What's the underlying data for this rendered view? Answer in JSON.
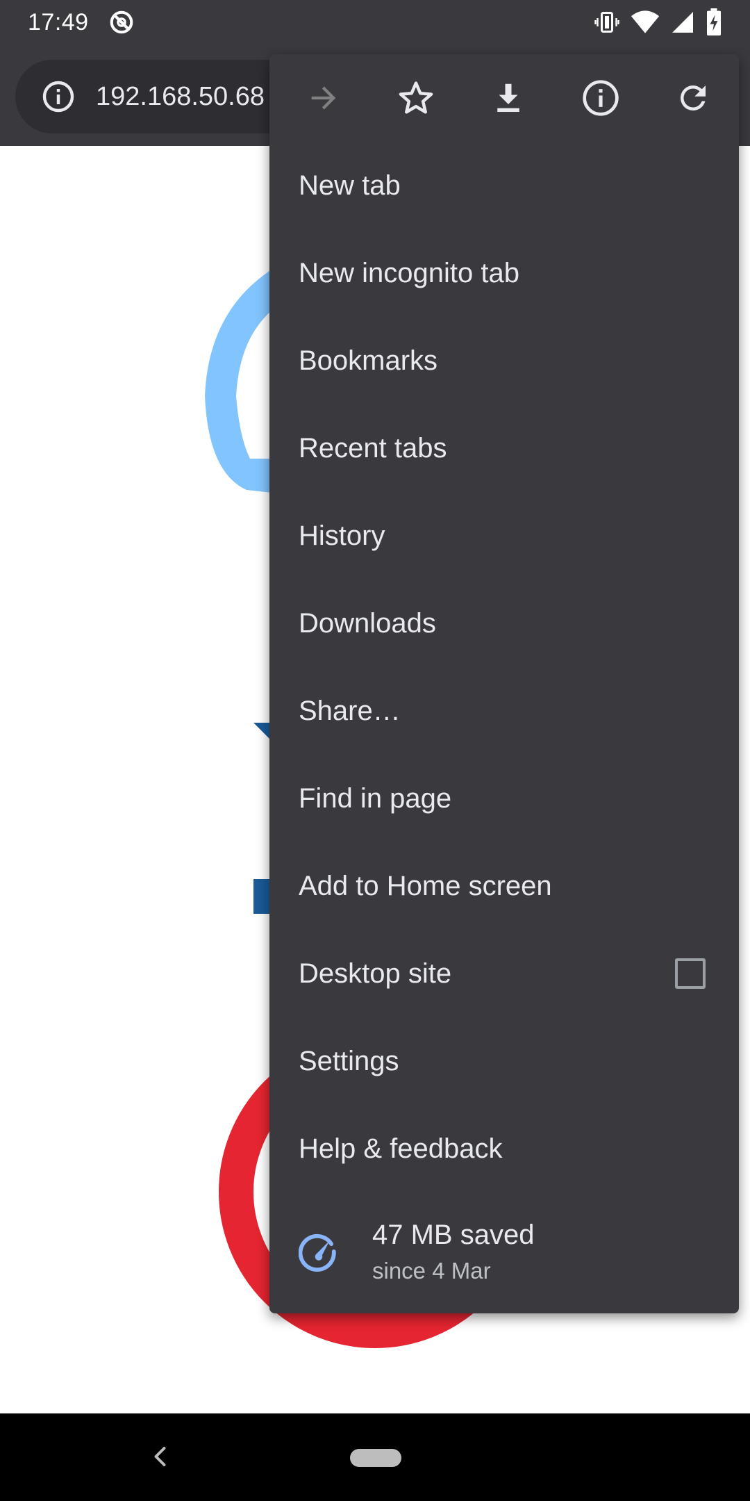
{
  "status_bar": {
    "time": "17:49",
    "icons": [
      "dnd-icon",
      "vibrate-icon",
      "wifi-icon",
      "signal-icon",
      "battery-charging-icon"
    ]
  },
  "toolbar": {
    "url": "192.168.50.68",
    "security_icon": "info-icon"
  },
  "menu": {
    "actions": [
      "forward-icon",
      "bookmark-star-icon",
      "download-icon",
      "page-info-icon",
      "reload-icon"
    ],
    "items": [
      {
        "label": "New tab"
      },
      {
        "label": "New incognito tab"
      },
      {
        "label": "Bookmarks"
      },
      {
        "label": "Recent tabs"
      },
      {
        "label": "History"
      },
      {
        "label": "Downloads"
      },
      {
        "label": "Share…"
      },
      {
        "label": "Find in page"
      },
      {
        "label": "Add to Home screen"
      },
      {
        "label": "Desktop site",
        "checked": false
      },
      {
        "label": "Settings"
      },
      {
        "label": "Help & feedback"
      }
    ],
    "data_saver": {
      "title": "47 MB saved",
      "subtitle": "since 4 Mar",
      "icon": "data-saver-gauge-icon"
    }
  },
  "colors": {
    "menu_bg": "#3a3a3e",
    "status_bg": "#3a3a3e",
    "accent_blue": "#8ab4f8",
    "page_light_blue": "#82c4fd",
    "page_dark_blue": "#1a5a96",
    "page_red": "#e52531"
  },
  "nav_bar": {
    "icons": [
      "back-icon",
      "home-pill"
    ]
  }
}
